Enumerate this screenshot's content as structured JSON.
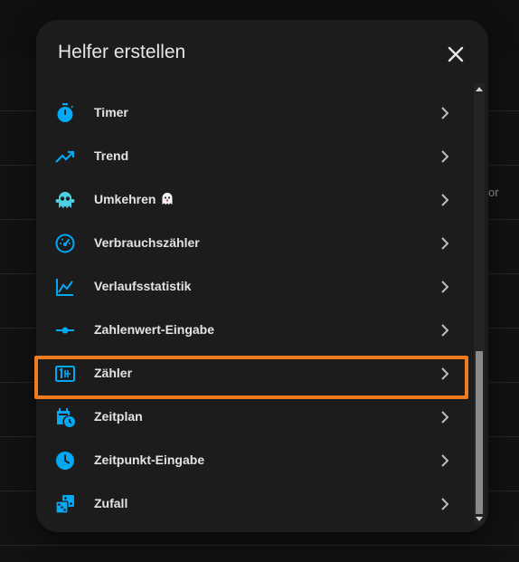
{
  "dialog": {
    "title": "Helfer erstellen",
    "close_icon": "close-icon"
  },
  "background": {
    "fragment_text": "or"
  },
  "items": [
    {
      "label": "Timer",
      "icon": "timer-icon"
    },
    {
      "label": "Trend",
      "icon": "trending-up-icon"
    },
    {
      "label": "Umkehren",
      "icon": "ghost-icon",
      "badge": "ghost-emoji"
    },
    {
      "label": "Verbrauchszähler",
      "icon": "gauge-icon"
    },
    {
      "label": "Verlaufsstatistik",
      "icon": "chart-line-icon"
    },
    {
      "label": "Zahlenwert-Eingabe",
      "icon": "slider-icon"
    },
    {
      "label": "Zähler",
      "icon": "counter-icon"
    },
    {
      "label": "Zeitplan",
      "icon": "calendar-clock-icon"
    },
    {
      "label": "Zeitpunkt-Eingabe",
      "icon": "clock-icon"
    },
    {
      "label": "Zufall",
      "icon": "dice-icon"
    }
  ],
  "highlighted_item": "Zähler",
  "colors": {
    "accent": "#03a9f4",
    "highlight": "#f07c1f",
    "dialog_bg": "#1c1c1c",
    "text": "#e3e3e3"
  }
}
